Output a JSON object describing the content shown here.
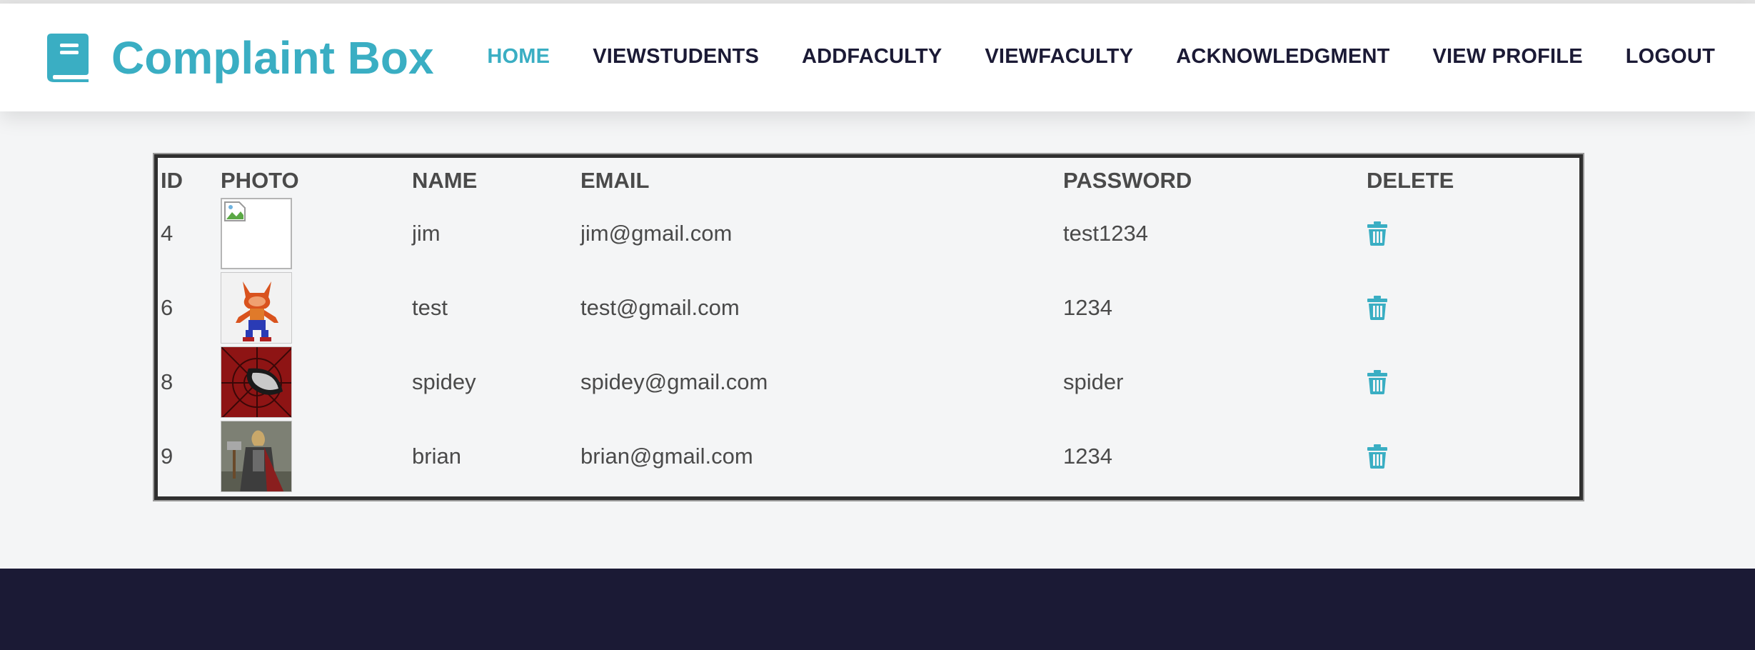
{
  "brand": {
    "title": "Complaint Box",
    "icon": "book-icon",
    "color": "#3aaec3"
  },
  "nav": {
    "items": [
      {
        "label": "HOME",
        "active": true
      },
      {
        "label": "VIEWSTUDENTS",
        "active": false
      },
      {
        "label": "ADDFACULTY",
        "active": false
      },
      {
        "label": "VIEWFACULTY",
        "active": false
      },
      {
        "label": "ACKNOWLEDGMENT",
        "active": false
      },
      {
        "label": "VIEW PROFILE",
        "active": false
      },
      {
        "label": "LOGOUT",
        "active": false
      }
    ]
  },
  "table": {
    "headers": {
      "id": "ID",
      "photo": "PHOTO",
      "name": "NAME",
      "email": "EMAIL",
      "password": "PASSWORD",
      "delete": "DELETE"
    },
    "rows": [
      {
        "id": "4",
        "name": "jim",
        "email": "jim@gmail.com",
        "password": "test1234",
        "photo": "broken-image-icon"
      },
      {
        "id": "6",
        "name": "test",
        "email": "test@gmail.com",
        "password": "1234",
        "photo": "orange-fox-character-photo"
      },
      {
        "id": "8",
        "name": "spidey",
        "email": "spidey@gmail.com",
        "password": "spider",
        "photo": "spider-mask-photo"
      },
      {
        "id": "9",
        "name": "brian",
        "email": "brian@gmail.com",
        "password": "1234",
        "photo": "armored-hero-photo"
      }
    ]
  },
  "colors": {
    "accent": "#3aaec3",
    "nav_text": "#1b1a35",
    "footer": "#1b1a35"
  }
}
